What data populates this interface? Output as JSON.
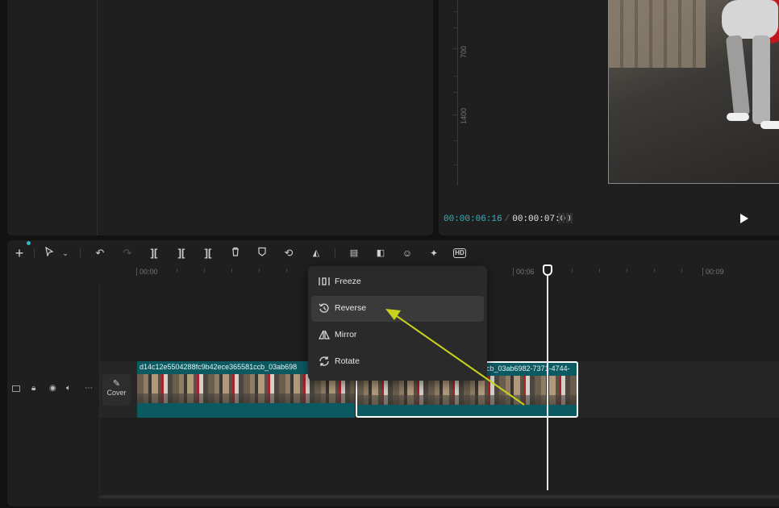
{
  "player": {
    "ruler_labels": [
      "700",
      "1400"
    ],
    "current_time": "00:00:06:16",
    "separator": "/",
    "total_time": "00:00:07:00"
  },
  "toolbar": {
    "icons": [
      "add-icon",
      "select-cursor-icon",
      "chevron-down-icon",
      "undo-icon",
      "redo-icon",
      "split-icon",
      "split-left-icon",
      "split-right-icon",
      "delete-icon",
      "marker-icon",
      "loop-icon",
      "speed-icon",
      "caption-icon",
      "crop-icon",
      "person-icon",
      "magic-icon",
      "hd-icon"
    ]
  },
  "time_ruler": {
    "labels": [
      "00:00",
      "00:06",
      "00:09"
    ]
  },
  "track": {
    "cover_label": "Cover",
    "clips": [
      {
        "label": "d14c12e5504288fc9b42ece365581ccb_03ab698"
      },
      {
        "label": "cb_03ab6982-7371-4744-"
      }
    ]
  },
  "context_menu": {
    "items": [
      {
        "label": "Freeze",
        "icon": "freeze-icon"
      },
      {
        "label": "Reverse",
        "icon": "reverse-icon"
      },
      {
        "label": "Mirror",
        "icon": "mirror-icon"
      },
      {
        "label": "Rotate",
        "icon": "rotate-icon"
      }
    ]
  },
  "colors": {
    "accent": "#2fb8c4",
    "clip": "#0b5a62",
    "annotation_arrow": "#c8d21e"
  }
}
